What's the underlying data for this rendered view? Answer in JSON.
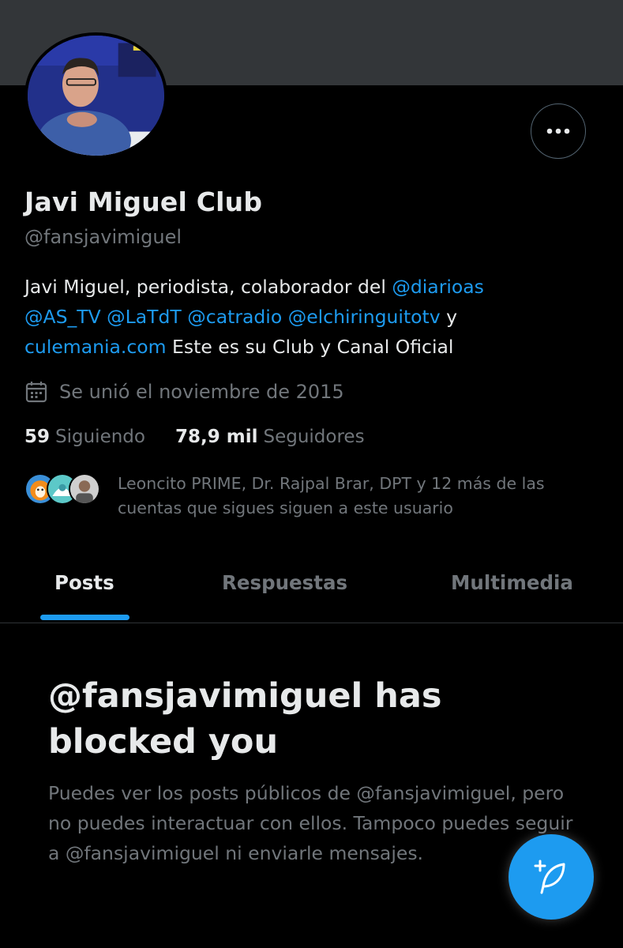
{
  "profile": {
    "display_name": "Javi Miguel Club",
    "handle": "@fansjavimiguel",
    "bio": {
      "line1_text": "Javi Miguel, periodista, colaborador del ",
      "line1_link": "@diarioas",
      "mention_as_tv": "@AS_TV",
      "mention_latdt": "@LaTdT",
      "mention_catradio": "@catradio",
      "mention_elchiringuito": "@elchiringuitotv",
      "y": " y",
      "website": "culemania.com",
      "line3_text": " Este es su Club y Canal Oficial"
    },
    "joined": "Se unió el noviembre de 2015",
    "following_count": "59",
    "following_label": "Siguiendo",
    "followers_count": "78,9 mil",
    "followers_label": "Seguidores",
    "followers_you_know": "Leoncito PRIME, Dr. Rajpal Brar, DPT y 12 más de las cuentas que sigues siguen a este usuario"
  },
  "tabs": [
    {
      "label": "Posts"
    },
    {
      "label": "Respuestas"
    },
    {
      "label": "Multimedia"
    }
  ],
  "blocked": {
    "title": "@fansjavimiguel has blocked you",
    "description": "Puedes ver los posts públicos de @fansjavimiguel, pero no puedes interactuar con ellos. Tampoco puedes seguir a @fansjavimiguel ni enviarle mensajes."
  },
  "icons": {
    "more": "more-horizontal-icon",
    "calendar": "calendar-icon",
    "compose": "compose-post-icon"
  },
  "colors": {
    "accent": "#1d9bf0",
    "background": "#000000",
    "secondary_text": "#71767b",
    "primary_text": "#e7e9ea"
  }
}
